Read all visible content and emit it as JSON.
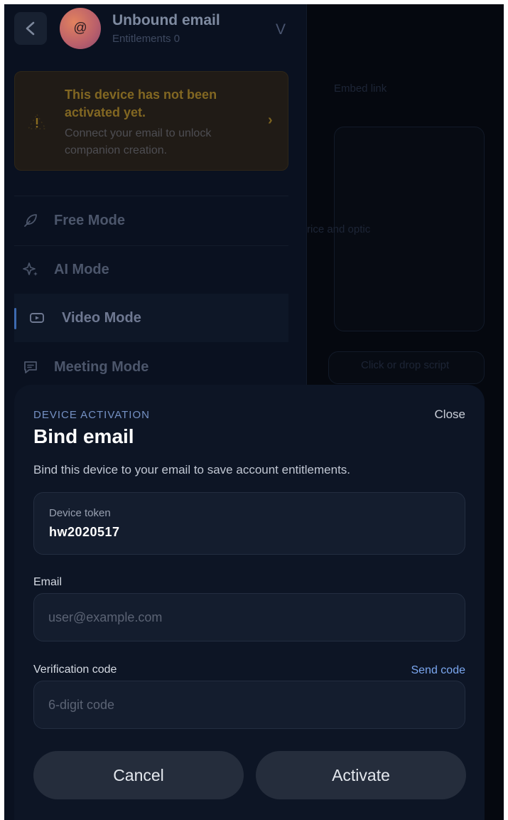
{
  "header": {
    "back_icon": "chevron-left-icon",
    "avatar_symbol": "@",
    "title": "Unbound email",
    "subtitle": "Entitlements 0",
    "expand_symbol": "V"
  },
  "alert": {
    "icon": "warning-icon",
    "title": "This device has not been activated yet.",
    "body": "Connect your email to unlock companion creation.",
    "chevron": "›",
    "accent_color": "#826722"
  },
  "nav": {
    "items": [
      {
        "label": "Free Mode",
        "icon": "feather-icon",
        "active": false
      },
      {
        "label": "AI Mode",
        "icon": "sparkle-icon",
        "active": false
      },
      {
        "label": "Video Mode",
        "icon": "video-icon",
        "active": true
      },
      {
        "label": "Meeting Mode",
        "icon": "chat-icon",
        "active": false
      }
    ]
  },
  "background": {
    "text1": "Embed link",
    "text2": "rice and optic",
    "text3": "Click or drop script"
  },
  "modal": {
    "eyebrow": "DEVICE ACTIVATION",
    "close_label": "Close",
    "title": "Bind email",
    "description": "Bind this device to your email to save account entitlements.",
    "token": {
      "label": "Device token",
      "value": "hw2020517"
    },
    "email": {
      "label": "Email",
      "value": "",
      "placeholder": "user@example.com"
    },
    "code": {
      "label": "Verification code",
      "value": "",
      "placeholder": "6-digit code",
      "send_label": "Send code"
    },
    "cancel_label": "Cancel",
    "activate_label": "Activate"
  },
  "colors": {
    "accent_blue": "#7ba7f0",
    "warning": "#826722",
    "modal_bg": "#0d1525"
  }
}
